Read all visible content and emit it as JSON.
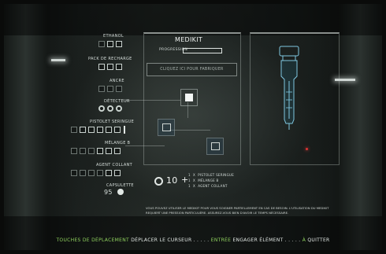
{
  "colors": {
    "accent_green": "#8fd15e",
    "hud_white": "#e1e7e4"
  },
  "inventory": {
    "ethanol": {
      "label": "ETHANOL"
    },
    "recharge": {
      "label": "PACK DE RECHARGE"
    },
    "ancre": {
      "label": "ANCRE"
    },
    "detecteur": {
      "label": "DÉTECTEUR"
    },
    "syringe": {
      "label": "PISTOLET SERINGUE"
    },
    "melange": {
      "label": "MÉLANGE B"
    },
    "agent": {
      "label": "AGENT COLLANT"
    },
    "capsules": {
      "label": "CAPSULETTE",
      "count": "95"
    }
  },
  "medikit": {
    "title": "MEDIKIT",
    "progress_label": "PROGRESSION",
    "progress_value": 0,
    "action_button": "CLIQUEZ ICI POUR FABRIQUER",
    "cost": "10",
    "recipe": [
      {
        "qty": "1",
        "name": "PISTOLET SERINGUE"
      },
      {
        "qty": "1",
        "name": "MÉLANGE B"
      },
      {
        "qty": "1",
        "name": "AGENT COLLANT"
      }
    ],
    "description": "VOUS POUVEZ UTILISER LE MEDIKIT POUR VOUS SOIGNER PARTIELLEMENT EN CAS DE BESOIN. L'UTILISATION DU MEDIKIT REQUIERT UNE PRESSION PARTICULIÈRE. ASSUREZ-VOUS BIEN D'AVOIR LE TEMPS NÉCESSAIRE."
  },
  "controls": {
    "move_key": "TOUCHES DE DÉPLACEMENT",
    "move_action": "DÉPLACER LE CURSEUR . . . . .",
    "enter_key": "ENTRÉE",
    "enter_action": "ENGAGER ÉLÉMENT . . . . .",
    "quit_key": "À",
    "quit_action": "QUITTER"
  }
}
